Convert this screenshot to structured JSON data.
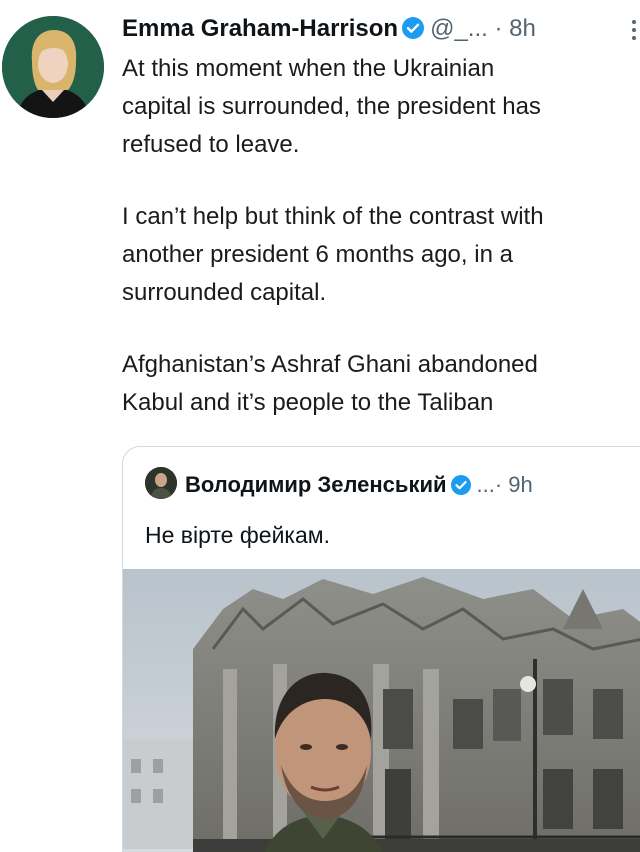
{
  "tweet": {
    "author_name": "Emma Graham-Harrison",
    "handle": "@_...",
    "separator": "·",
    "time": "8h",
    "paragraphs": [
      [
        "At this moment when the Ukrainian",
        "capital is surrounded, the president has",
        "refused to leave."
      ],
      [
        "I can’t help but think of the contrast with",
        "another president 6 months ago, in a",
        "surrounded capital."
      ],
      [
        "Afghanistan’s Ashraf Ghani abandoned",
        "Kabul and it’s people to the Taliban"
      ]
    ]
  },
  "quote": {
    "author_name": "Володимир Зеленський",
    "meta": "...· 9h",
    "text": "Не вірте фейкам."
  },
  "colors": {
    "verified": "#1d9bf0",
    "secondary_text": "#536471",
    "card_border": "#cfd9de"
  },
  "icons": {
    "verified": "verified-badge-icon",
    "more": "more-vertical-icon"
  }
}
